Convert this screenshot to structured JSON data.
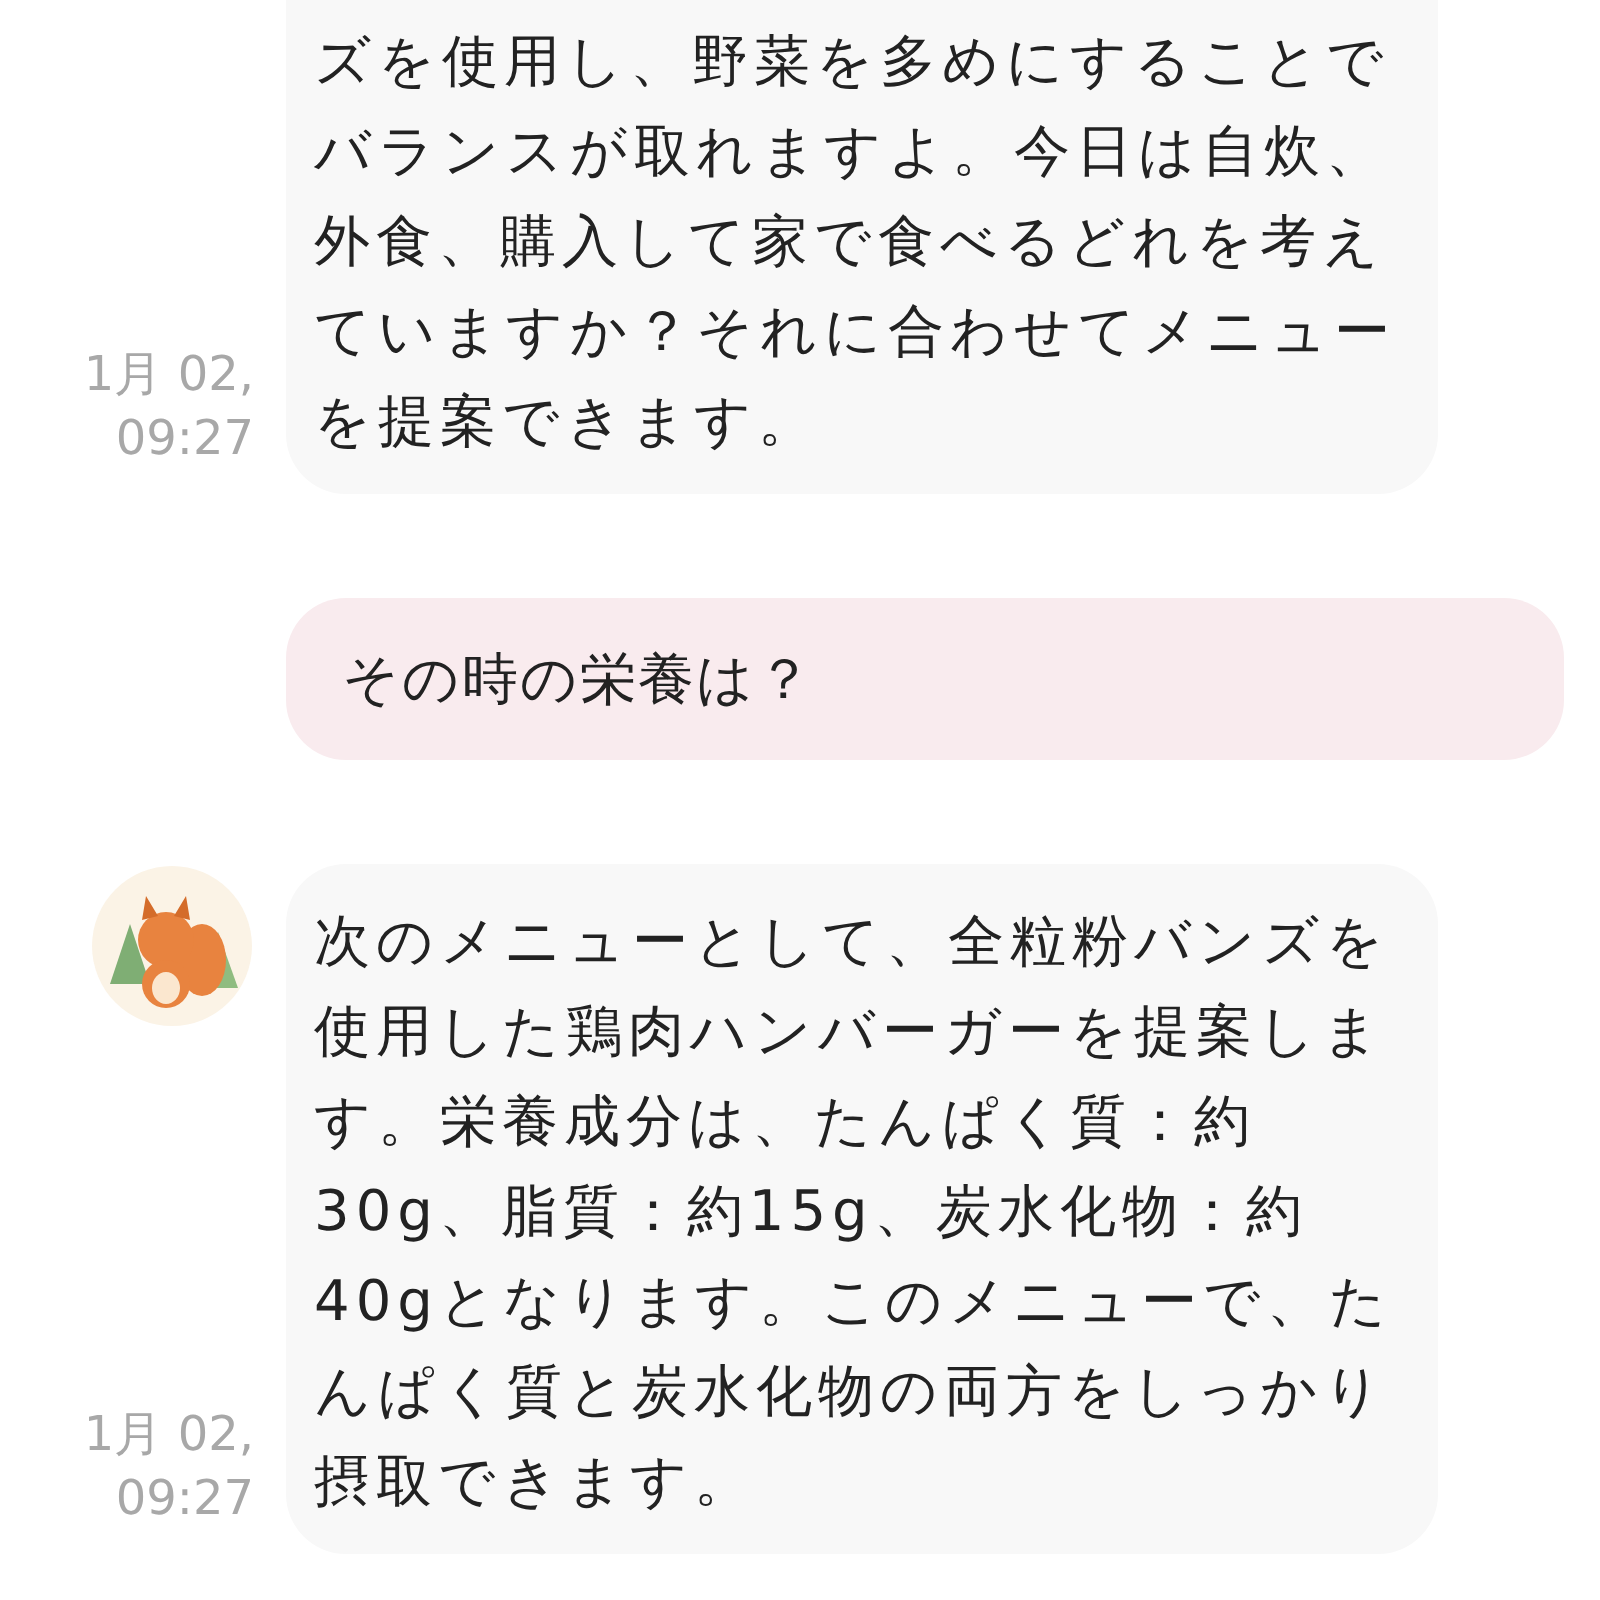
{
  "messages": [
    {
      "kind": "bot",
      "text": "ズを使用し、野菜を多めにすることでバランスが取れますよ。今日は自炊、外食、購入して家で食べるどれを考えていますか？それに合わせてメニューを提案できます。",
      "date": "1月 02,",
      "time": "09:27",
      "avatar": false
    },
    {
      "kind": "user",
      "text": "その時の栄養は？"
    },
    {
      "kind": "bot",
      "text": " 次のメニューとして、全粒粉バンズを使用した鶏肉ハンバーガーを提案します。栄養成分は、たんぱく質：約30g、脂質：約15g、炭水化物：約40gとなります。このメニューで、たんぱく質と炭水化物の両方をしっかり摂取できます。",
      "date": "1月 02,",
      "time": "09:27",
      "avatar": true
    }
  ]
}
